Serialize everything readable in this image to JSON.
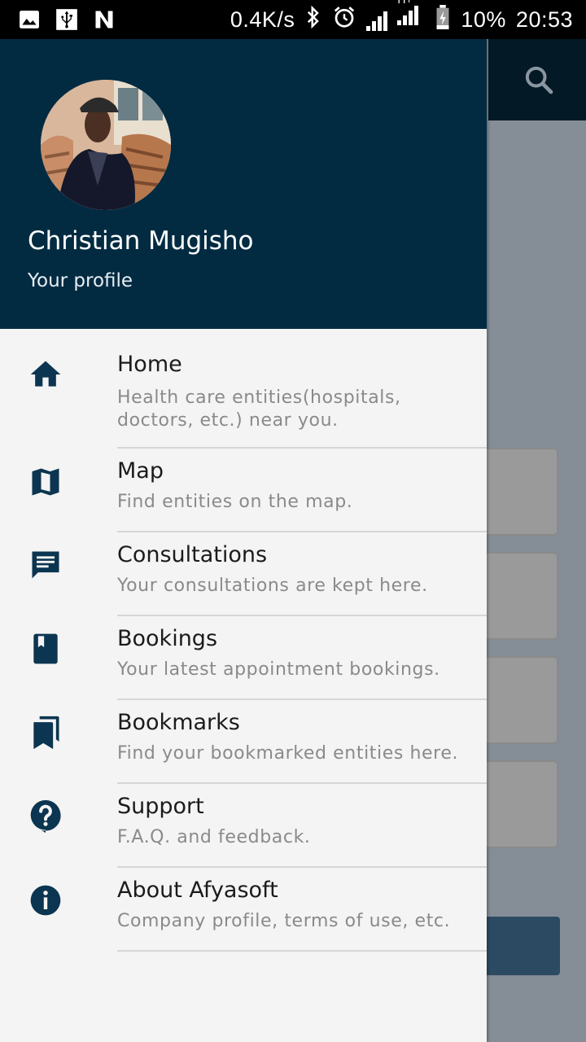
{
  "status_bar": {
    "speed": "0.4K/s",
    "network": "H+",
    "battery": "10%",
    "time": "20:53"
  },
  "colors": {
    "header_bg": "#022b42",
    "icon_color": "#0b3550",
    "drawer_bg": "#f4f4f4"
  },
  "profile": {
    "name": "Christian Mugisho",
    "subtitle": "Your profile"
  },
  "menu": [
    {
      "icon": "home-icon",
      "title": "Home",
      "desc": "Health care entities(hospitals, doctors, etc.) near you."
    },
    {
      "icon": "map-icon",
      "title": "Map",
      "desc": "Find entities on the map."
    },
    {
      "icon": "chat-icon",
      "title": "Consultations",
      "desc": "Your consultations are kept here."
    },
    {
      "icon": "book-icon",
      "title": "Bookings",
      "desc": "Your latest appointment bookings."
    },
    {
      "icon": "bookmarks-icon",
      "title": "Bookmarks",
      "desc": "Find your bookmarked entities here."
    },
    {
      "icon": "help-icon",
      "title": "Support",
      "desc": "F.A.Q. and feedback."
    },
    {
      "icon": "info-icon",
      "title": "About Afyasoft",
      "desc": "Company profile, terms of use, etc."
    }
  ]
}
